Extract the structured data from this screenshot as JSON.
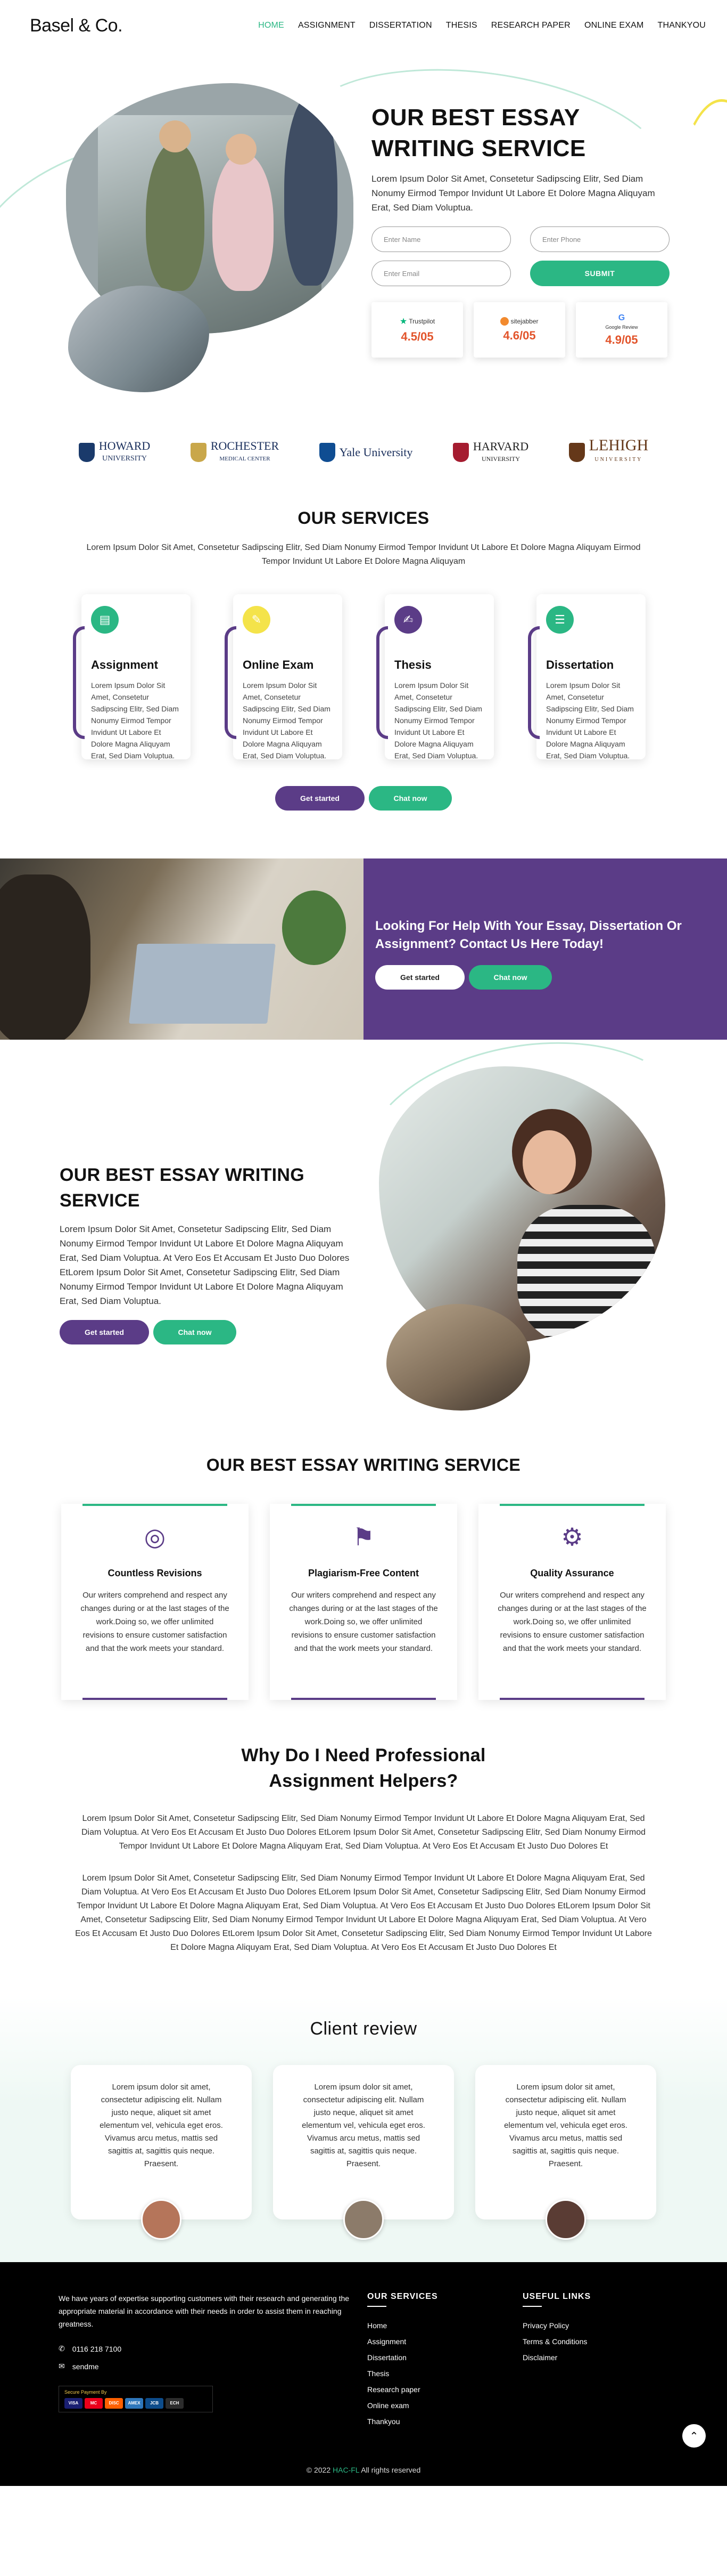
{
  "header": {
    "logo": "Basel & Co.",
    "menu": [
      "HOME",
      "ASSIGNMENT",
      "DISSERTATION",
      "THESIS",
      "RESEARCH PAPER",
      "ONLINE EXAM",
      "THANKYOU"
    ],
    "active": "HOME"
  },
  "hero": {
    "title_line1": "OUR BEST ESSAY",
    "title_line2": "WRITING SERVICE",
    "text": "Lorem Ipsum Dolor Sit Amet, Consetetur Sadipscing Elitr, Sed Diam Nonumy Eirmod Tempor Invidunt Ut Labore Et Dolore Magna Aliquyam Erat, Sed Diam Voluptua.",
    "name_placeholder": "Enter Name",
    "phone_placeholder": "Enter Phone",
    "email_placeholder": "Enter Email",
    "submit_label": "SUBMIT",
    "ratings": [
      {
        "source": "Trustpilot",
        "score": "4.5/05"
      },
      {
        "source": "sitejabber",
        "score": "4.6/05"
      },
      {
        "source": "Google Review",
        "score": "4.9/05"
      }
    ]
  },
  "universities": [
    {
      "line1": "HOWARD",
      "line2": "UNIVERSITY",
      "color": "#1a3a6b"
    },
    {
      "line1": "ROCHESTER",
      "line2": "MEDICAL CENTER",
      "color": "#1a3a6b"
    },
    {
      "line1": "Yale University",
      "line2": "",
      "color": "#1a3a6b"
    },
    {
      "line1": "HARVARD",
      "line2": "UNIVERSITY",
      "color": "#a51c30"
    },
    {
      "line1": "LEHIGH",
      "line2": "UNIVERSITY",
      "color": "#653819"
    }
  ],
  "services": {
    "title": "OUR SERVICES",
    "subtitle": "Lorem Ipsum Dolor Sit Amet, Consetetur Sadipscing Elitr, Sed Diam Nonumy Eirmod Tempor Invidunt Ut Labore Et Dolore Magna Aliquyam Eirmod Tempor Invidunt Ut Labore Et Dolore Magna Aliquyam",
    "cards": [
      {
        "title": "Assignment",
        "text": "Lorem Ipsum Dolor Sit Amet, Consetetur Sadipscing Elitr, Sed Diam Nonumy Eirmod Tempor Invidunt Ut Labore Et Dolore Magna Aliquyam Erat, Sed Diam Voluptua.",
        "icon_color": "#2bb784",
        "icon": "document-icon"
      },
      {
        "title": "Online Exam",
        "text": "Lorem Ipsum Dolor Sit Amet, Consetetur Sadipscing Elitr, Sed Diam Nonumy Eirmod Tempor Invidunt Ut Labore Et Dolore Magna Aliquyam Erat, Sed Diam Voluptua.",
        "icon_color": "#f4e34a",
        "icon": "exam-icon"
      },
      {
        "title": "Thesis",
        "text": "Lorem Ipsum Dolor Sit Amet, Consetetur Sadipscing Elitr, Sed Diam Nonumy Eirmod Tempor Invidunt Ut Labore Et Dolore Magna Aliquyam Erat, Sed Diam Voluptua.",
        "icon_color": "#5b3c87",
        "icon": "thesis-icon"
      },
      {
        "title": "Dissertation",
        "text": "Lorem Ipsum Dolor Sit Amet, Consetetur Sadipscing Elitr, Sed Diam Nonumy Eirmod Tempor Invidunt Ut Labore Et Dolore Magna Aliquyam Erat, Sed Diam Voluptua.",
        "icon_color": "#2bb784",
        "icon": "dissertation-icon"
      }
    ],
    "btn_started": "Get started",
    "btn_chat": "Chat now"
  },
  "banner": {
    "title": "Looking For Help With Your Essay, Dissertation Or Assignment? Contact Us Here Today!",
    "btn_started": "Get started",
    "btn_chat": "Chat now"
  },
  "best2": {
    "title_line1": "OUR BEST ESSAY WRITING",
    "title_line2": "SERVICE",
    "text": "Lorem Ipsum Dolor Sit Amet, Consetetur Sadipscing Elitr, Sed Diam Nonumy Eirmod Tempor Invidunt Ut Labore Et Dolore Magna Aliquyam Erat, Sed Diam Voluptua. At Vero Eos Et Accusam Et Justo Duo Dolores EtLorem Ipsum Dolor Sit Amet, Consetetur Sadipscing Elitr, Sed Diam Nonumy Eirmod Tempor Invidunt Ut Labore Et Dolore Magna Aliquyam Erat, Sed Diam Voluptua.",
    "btn_started": "Get started",
    "btn_chat": "Chat now"
  },
  "features": {
    "title": "OUR BEST ESSAY WRITING SERVICE",
    "cards": [
      {
        "title": "Countless Revisions",
        "text": "Our writers comprehend and respect any changes during or at the last stages of the work.Doing so, we offer unlimited revisions to ensure customer satisfaction and that the work meets your standard."
      },
      {
        "title": "Plagiarism-Free Content",
        "text": "Our writers comprehend and respect any changes during or at the last stages of the work.Doing so, we offer unlimited revisions to ensure customer satisfaction and that the work meets your standard."
      },
      {
        "title": "Quality Assurance",
        "text": "Our writers comprehend and respect any changes during or at the last stages of the work.Doing so, we offer unlimited revisions to ensure customer satisfaction and that the work meets your standard."
      }
    ]
  },
  "why": {
    "title": "Why Do I Need Professional Assignment Helpers?",
    "para1": "Lorem Ipsum Dolor Sit Amet, Consetetur Sadipscing Elitr, Sed Diam Nonumy Eirmod Tempor Invidunt Ut Labore Et Dolore Magna Aliquyam Erat, Sed Diam Voluptua. At Vero Eos Et Accusam Et Justo Duo Dolores EtLorem Ipsum Dolor Sit Amet, Consetetur Sadipscing Elitr, Sed Diam Nonumy Eirmod Tempor Invidunt Ut Labore Et Dolore Magna Aliquyam Erat, Sed Diam Voluptua. At Vero Eos Et Accusam Et Justo Duo Dolores Et",
    "para2": "Lorem Ipsum Dolor Sit Amet, Consetetur Sadipscing Elitr, Sed Diam Nonumy Eirmod Tempor Invidunt Ut Labore Et Dolore Magna Aliquyam Erat, Sed Diam Voluptua. At Vero Eos Et Accusam Et Justo Duo Dolores EtLorem Ipsum Dolor Sit Amet, Consetetur Sadipscing Elitr, Sed Diam Nonumy Eirmod Tempor Invidunt Ut Labore Et Dolore Magna Aliquyam Erat, Sed Diam Voluptua. At Vero Eos Et Accusam Et Justo Duo Dolores EtLorem Ipsum Dolor Sit Amet, Consetetur Sadipscing Elitr, Sed Diam Nonumy Eirmod Tempor Invidunt Ut Labore Et Dolore Magna Aliquyam Erat, Sed Diam Voluptua. At Vero Eos Et Accusam Et Justo Duo Dolores EtLorem Ipsum Dolor Sit Amet, Consetetur Sadipscing Elitr, Sed Diam Nonumy Eirmod Tempor Invidunt Ut Labore Et Dolore Magna Aliquyam Erat, Sed Diam Voluptua. At Vero Eos Et Accusam Et Justo Duo Dolores Et"
  },
  "reviews": {
    "title": "Client review",
    "cards": [
      {
        "text": "Lorem ipsum dolor sit amet, consectetur adipiscing elit. Nullam justo neque, aliquet sit amet elementum vel, vehicula eget eros. Vivamus arcu metus, mattis sed sagittis at, sagittis quis neque. Praesent.",
        "avatar_color": "#b5755a"
      },
      {
        "text": "Lorem ipsum dolor sit amet, consectetur adipiscing elit. Nullam justo neque, aliquet sit amet elementum vel, vehicula eget eros. Vivamus arcu metus, mattis sed sagittis at, sagittis quis neque. Praesent.",
        "avatar_color": "#8c7b6a"
      },
      {
        "text": "Lorem ipsum dolor sit amet, consectetur adipiscing elit. Nullam justo neque, aliquet sit amet elementum vel, vehicula eget eros. Vivamus arcu metus, mattis sed sagittis at, sagittis quis neque. Praesent.",
        "avatar_color": "#5a3c34"
      }
    ]
  },
  "footer": {
    "about": "We have years of expertise supporting customers with their research and generating the appropriate material in accordance with their needs in order to assist them in reaching greatness.",
    "phone": "0116 218 7100",
    "email": "sendme",
    "pay_title": "Secure Payment By",
    "services_head": "OUR SERVICES",
    "services": [
      "Home",
      "Assignment",
      "Dissertation",
      "Thesis",
      "Research paper",
      "Online exam",
      "Thankyou"
    ],
    "links_head": "USEFUL LINKS",
    "links": [
      "Privacy Policy",
      "Terms & Conditions",
      "Disclaimer"
    ],
    "copy_pre": "© 2022",
    "copy_brand": "HAC-FL",
    "copy_post": "All rights reserved"
  }
}
